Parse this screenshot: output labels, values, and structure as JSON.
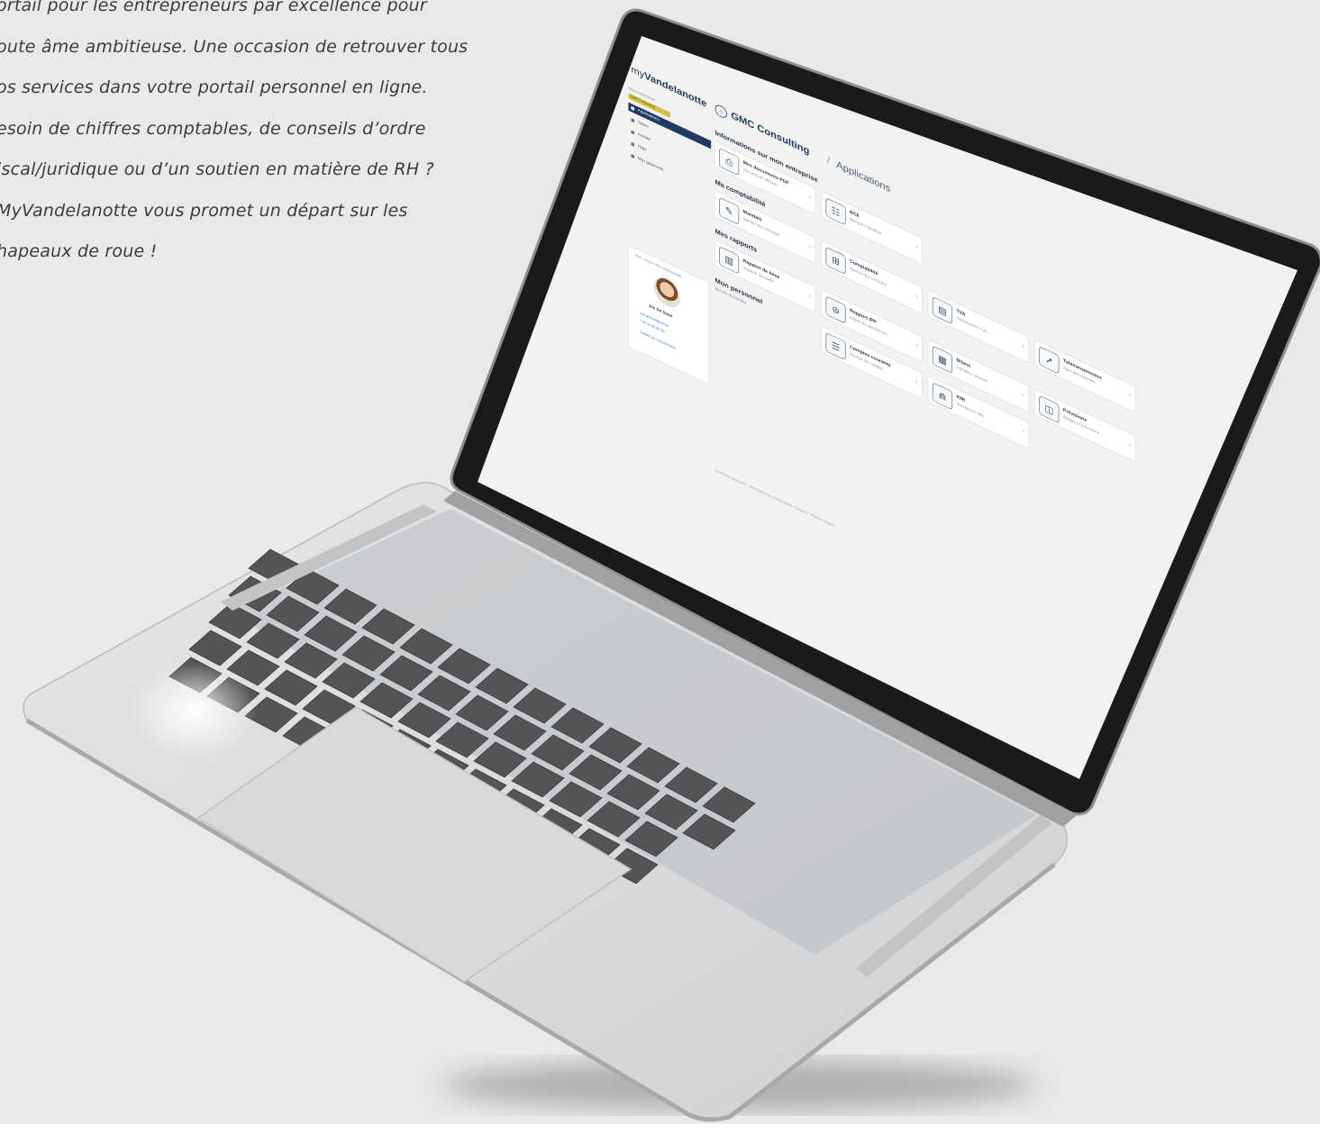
{
  "intro": {
    "lines": [
      "ortail pour les entrepreneurs par excellence pour",
      "oute âme ambitieuse. Une occasion de retrouver tous",
      "os services dans votre portail personnel en ligne.",
      "esoin de chiffres comptables, de conseils d’ordre",
      "iscal/juridique ou d’un soutien en matière de RH ?",
      "MyVandelanotte vous promet un départ sur les",
      "hapeaux de roue !"
    ]
  },
  "app": {
    "logo_prefix": "my",
    "logo_brand": "Vandelanotte",
    "sidebar": {
      "small_label": "Mon entreprise",
      "badge": "GMC Consulting",
      "nav": [
        "Applications",
        "Taken",
        "Archief",
        "Hulp",
        "Mijn gegevens"
      ]
    },
    "contact": {
      "label": "Mon contact chez Vandelanotte",
      "name": "Jos De Smet",
      "email": "jos.desmet@vdl.be",
      "phone": "+32 56 00 00 00",
      "link": "Toutes les coordonnées"
    },
    "header": {
      "company": "GMC Consulting",
      "separator": "/",
      "page": "Applications"
    },
    "sections": {
      "company_info": "Informations sur mon entreprise",
      "accounting": "Ma comptabilité",
      "reports": "Mes rapports",
      "personnel": "Mon personnel",
      "personnel_note": "Bientôt disponible"
    },
    "apps": {
      "a1": {
        "title": "Mes documents PDF",
        "sub": "Documents officiels",
        "icon": "⎙"
      },
      "a2": {
        "title": "BCE",
        "sub": "Banque-Carrefour",
        "icon": "☷"
      },
      "a3": {
        "title": "Mandats",
        "sub": "Aperçu des mandats",
        "icon": "✎"
      },
      "a4": {
        "title": "Comptabilité",
        "sub": "Aperçu des comptes",
        "icon": "⊞"
      },
      "a5": {
        "title": "TVA",
        "sub": "Déclarations TVA",
        "icon": "▤"
      },
      "a6": {
        "title": "Télétransmission",
        "sub": "Suivi des dossiers",
        "icon": "➚"
      },
      "a7": {
        "title": "Rapport de base",
        "sub": "Analyse annuelle",
        "icon": "▥"
      },
      "a8": {
        "title": "Rapport IPP",
        "sub": "Impôt des personnes",
        "icon": "⊜"
      },
      "a9": {
        "title": "Bilans",
        "sub": "Comptes annuels",
        "icon": "▦"
      },
      "a10": {
        "title": "Prévisions",
        "sub": "Budget et prévisions",
        "icon": "◫"
      },
      "a11": {
        "title": "Comptes courants",
        "sub": "Aperçu des soldes",
        "icon": "☰"
      },
      "a12": {
        "title": "KMI",
        "sub": "Indicateurs clés",
        "icon": "⋒"
      }
    },
    "footer": "Conditions générales · Déclaration de confidentialité · Cookies · Mentions légales"
  }
}
